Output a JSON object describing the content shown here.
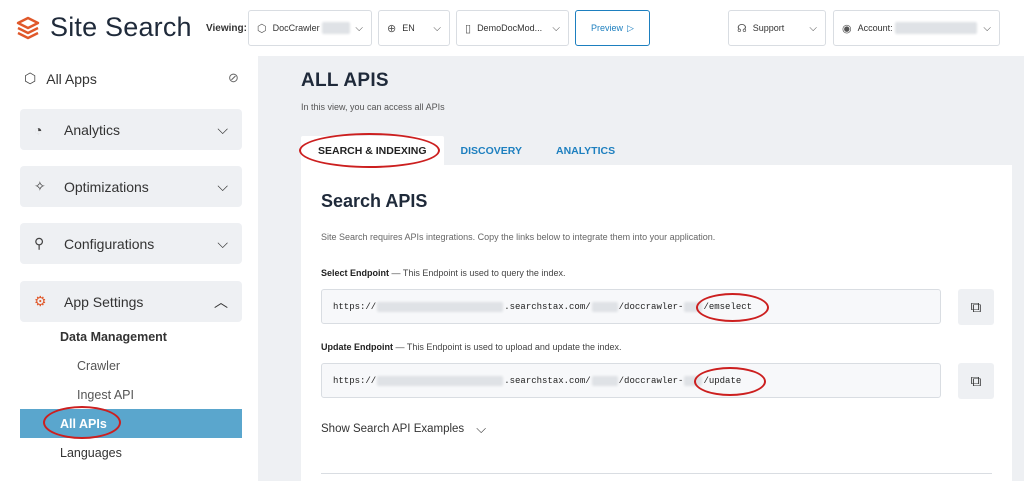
{
  "header": {
    "brand": "Site Search",
    "viewing_label": "Viewing:",
    "app_selector": "DocCrawler",
    "language": "EN",
    "model_selector": "DemoDocMod...",
    "preview": "Preview",
    "support": "Support",
    "account": "Account:"
  },
  "sidebar": {
    "all_apps": "All Apps",
    "sections": [
      {
        "label": "Analytics"
      },
      {
        "label": "Optimizations"
      },
      {
        "label": "Configurations"
      },
      {
        "label": "App Settings"
      }
    ],
    "sub_heading": "Data Management",
    "sub_items": [
      "Crawler",
      "Ingest API",
      "All APIs"
    ],
    "languages": "Languages"
  },
  "main": {
    "title": "ALL APIS",
    "subtitle": "In this view, you can access all APIs",
    "tabs": [
      "SEARCH & INDEXING",
      "DISCOVERY",
      "ANALYTICS"
    ],
    "panel": {
      "title": "Search APIS",
      "description": "Site Search requires APIs integrations. Copy the links below to integrate them into your application.",
      "select": {
        "label": "Select Endpoint",
        "desc": " — This Endpoint is used to query the index.",
        "url_start": "https://",
        "url_mid1": ".searchstax.com/",
        "url_mid2": "/doccrawler-",
        "url_end": "/emselect"
      },
      "update": {
        "label": "Update Endpoint",
        "desc": " — This Endpoint is used to upload and update the index.",
        "url_start": "https://",
        "url_mid1": ".searchstax.com/",
        "url_mid2": "/doccrawler-",
        "url_end": "/update"
      },
      "examples": "Show Search API Examples"
    }
  },
  "colors": {
    "accent_blue": "#1d7fbf",
    "active_nav": "#5aa6cd",
    "brand_orange": "#e0582a",
    "annotation_red": "#cc1f1f"
  }
}
